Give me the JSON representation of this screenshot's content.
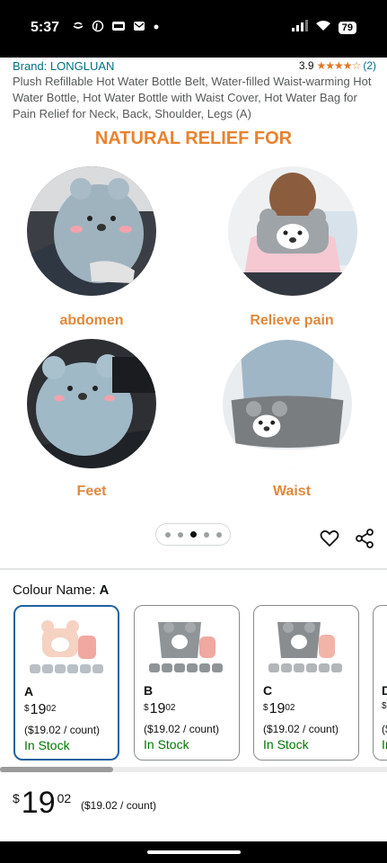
{
  "status_bar": {
    "time": "5:37",
    "battery": "79",
    "left_icons": [
      "tiktok-icon",
      "pinterest-icon",
      "temu-icon",
      "mail-icon"
    ],
    "right_icons": [
      "signal-icon",
      "wifi-icon",
      "battery-icon"
    ]
  },
  "product": {
    "brand": "Brand: LONGLUAN",
    "rating_value": "3.9",
    "rating_stars": "★★★★☆",
    "rating_count": "(2)",
    "title": "Plush Refillable Hot Water Bottle Belt, Water-filled Waist-warming Hot Water Bottle, Hot Water Bottle with Waist Cover, Hot Water Bag for Pain Relief for Neck, Back, Shoulder, Legs (A)"
  },
  "hero": {
    "heading": "NATURAL RELIEF FOR",
    "items": [
      {
        "label": "abdomen"
      },
      {
        "label": "Relieve pain"
      },
      {
        "label": "Feet"
      },
      {
        "label": "Waist"
      }
    ],
    "dots_total": 5,
    "dots_active": 3
  },
  "colour": {
    "label": "Colour Name:",
    "selected": "A",
    "variants": [
      {
        "name": "A",
        "dollars": "19",
        "cents": "02",
        "currency": "$",
        "unit": "($19.02 / count)",
        "stock": "In Stock"
      },
      {
        "name": "B",
        "dollars": "19",
        "cents": "02",
        "currency": "$",
        "unit": "($19.02 / count)",
        "stock": "In Stock"
      },
      {
        "name": "C",
        "dollars": "19",
        "cents": "02",
        "currency": "$",
        "unit": "($19.02 / count)",
        "stock": "In Stock"
      },
      {
        "name": "D",
        "dollars": "",
        "cents": "",
        "currency": "$",
        "unit": "($",
        "stock": "In"
      }
    ]
  },
  "price": {
    "currency": "$",
    "dollars": "19",
    "cents": "02",
    "unit": "($19.02 / count)"
  },
  "colors": {
    "link": "#007185",
    "accent_orange": "#e8822e",
    "stock_green": "#007600",
    "selected_border": "#2162a1",
    "star": "#de7921"
  }
}
